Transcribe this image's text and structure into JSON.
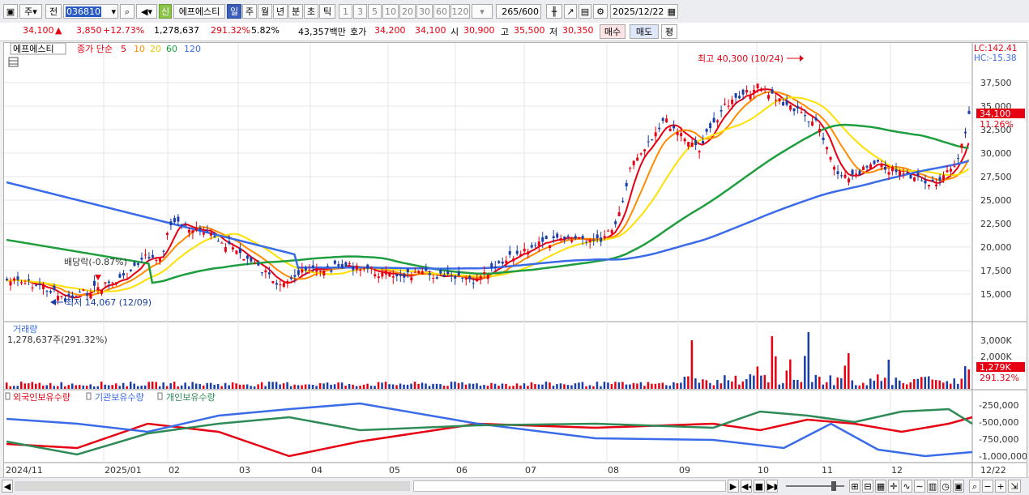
{
  "toolbar": {
    "code_type": "주",
    "prefix": "전",
    "stock_code": "036810",
    "stock_badge": "신",
    "stock_name": "에프에스티",
    "periods": [
      "일",
      "주",
      "월",
      "년",
      "분",
      "초",
      "틱"
    ],
    "active_period": "일",
    "intervals": [
      "1",
      "3",
      "5",
      "10",
      "20",
      "30",
      "60",
      "120"
    ],
    "count": "265",
    "count_total": "/600",
    "date": "2025/12/22"
  },
  "quote": {
    "price": "34,100",
    "arrow": "▲",
    "change": "3,850",
    "change_pct": "+12.73%",
    "volume": "1,278,637",
    "volume_ratio": "291.32%",
    "turnover": "5.82%",
    "amount": "43,357백만",
    "ask_label": "호가",
    "ask1": "34,200",
    "ask2": "34,100",
    "open_label": "시",
    "open": "30,900",
    "high_label": "고",
    "high": "35,500",
    "low_label": "저",
    "low": "30,350",
    "buy_label": "매수",
    "sell_label": "매도",
    "eval_label": "평"
  },
  "price_panel": {
    "legend_name": "에프에스티",
    "legend_ma_label": "종가 단순",
    "ma_periods": [
      "5",
      "10",
      "20",
      "60",
      "120"
    ],
    "lc": "LC:142.41",
    "hc": "HC:-15.38",
    "y_ticks": [
      "37,500",
      "35,000",
      "32,500",
      "30,000",
      "27,500",
      "25,000",
      "22,500",
      "20,000",
      "17,500",
      "15,000"
    ],
    "last_price_tag": "34,100",
    "last_pct_tag": "11.26%",
    "high_annotation": "최고 40,300 (10/24)",
    "low_annotation": "최저 14,067 (12/09)",
    "dividend_annotation": "배당락(-0.87%)"
  },
  "volume_panel": {
    "title": "거래량",
    "value": "1,278,637주(291.32%)",
    "y_ticks": [
      "3,000K",
      "2,000K"
    ],
    "last_tag": "1,279K",
    "last_pct": "291.32%"
  },
  "holding_panel": {
    "legends": [
      "외국인보유수량",
      "기관보유수량",
      "개인보유수량"
    ],
    "y_ticks": [
      "-250,000",
      "-500,000",
      "-750,000",
      "-1,000,000"
    ]
  },
  "x_axis": [
    "2024/11",
    "2025/01",
    "02",
    "03",
    "04",
    "05",
    "06",
    "07",
    "08",
    "09",
    "10",
    "11",
    "12",
    "12/22"
  ],
  "colors": {
    "ma5": "#e60012",
    "ma10": "#ff8c00",
    "ma20": "#ffe000",
    "ma60": "#1e9e3e",
    "ma120": "#3a6be8",
    "up": "#e60012",
    "down": "#1a3ea8",
    "foreign": "#e60012",
    "institution": "#3a6be8",
    "individual": "#2e8b57"
  }
}
